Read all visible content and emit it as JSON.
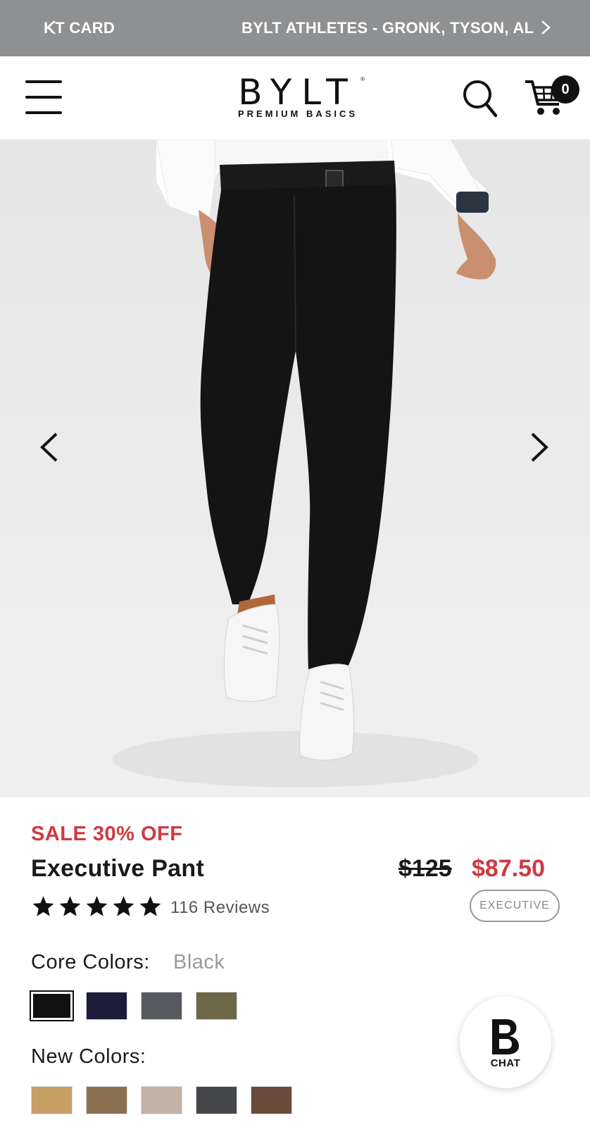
{
  "announcement": {
    "left_text": "KT CARD",
    "right_text": "BYLT ATHLETES - GRONK, TYSON, AL",
    "prev_icon": "chevron-left-icon",
    "next_icon": "chevron-right-icon",
    "background": "#8f9092"
  },
  "header": {
    "menu_icon": "hamburger-menu-icon",
    "logo_text": "BYLT",
    "logo_tagline": "PREMIUM BASICS",
    "logo_mark": "®",
    "search_icon": "search-icon",
    "cart_icon": "cart-icon",
    "cart_count": "0"
  },
  "gallery": {
    "image_alt": "Model wearing black Executive Pant with white shirt and white sneakers",
    "prev_icon": "chevron-left-icon",
    "next_icon": "chevron-right-icon"
  },
  "product": {
    "sale_label": "SALE 30% OFF",
    "title": "Executive Pant",
    "original_price": "$125",
    "sale_price": "$87.50",
    "rating": 5,
    "review_count": "116 Reviews",
    "fit_badge": "EXECUTIVE",
    "core_colors_label": "Core Colors:",
    "selected_color": "Black",
    "core_colors": [
      {
        "name": "Black",
        "hex": "#111111",
        "selected": true
      },
      {
        "name": "Navy",
        "hex": "#1d1c3a",
        "selected": false
      },
      {
        "name": "Grey",
        "hex": "#575a5e",
        "selected": false
      },
      {
        "name": "Olive",
        "hex": "#6e6749",
        "selected": false
      }
    ],
    "new_colors_label": "New Colors:",
    "new_colors": [
      {
        "name": "Tan",
        "hex": "#c79e63"
      },
      {
        "name": "Brown",
        "hex": "#8b7151"
      },
      {
        "name": "Stone",
        "hex": "#c2b2a5"
      },
      {
        "name": "Charcoal",
        "hex": "#45474a"
      },
      {
        "name": "Chocolate",
        "hex": "#6a4a3a"
      }
    ],
    "accent_color": "#cf3a3f"
  },
  "chat": {
    "label": "CHAT",
    "icon": "bylt-b-logo-icon"
  }
}
